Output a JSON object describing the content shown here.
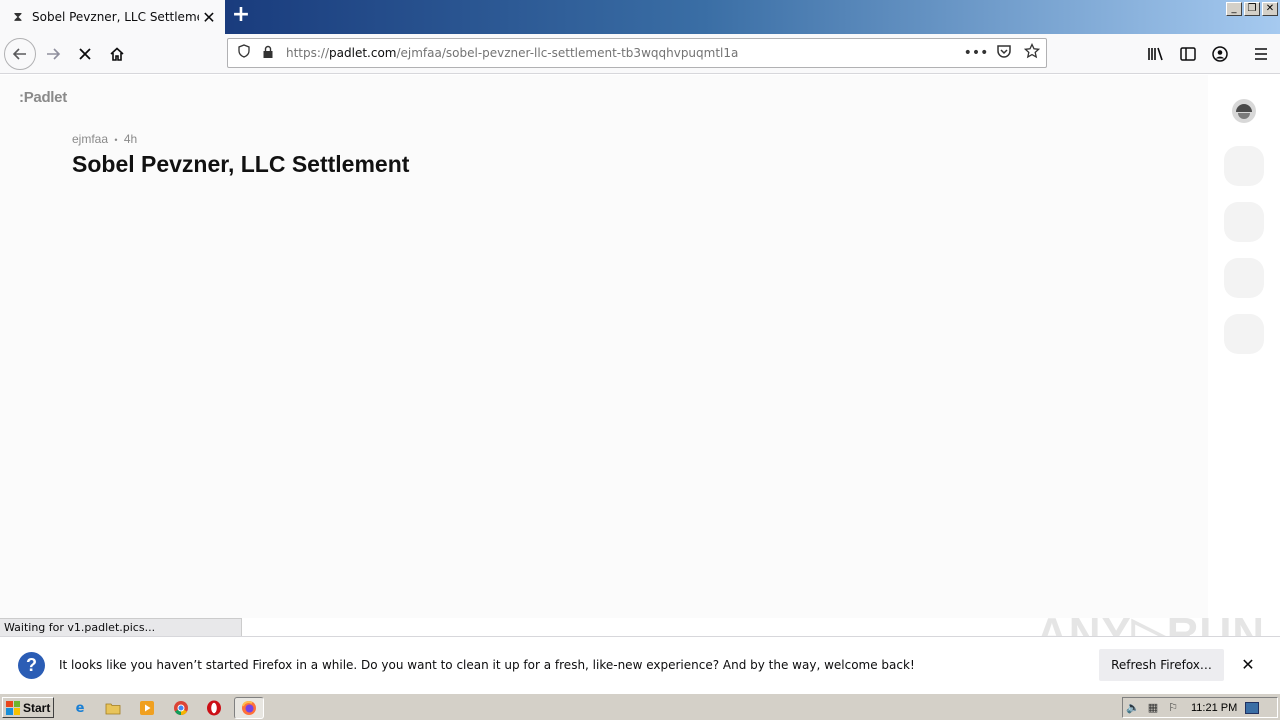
{
  "browser": {
    "tab": {
      "title": "Sobel Pevzner, LLC Settlement",
      "favicon": "hourglass-icon"
    },
    "new_tab_label": "+",
    "window_controls": [
      "_",
      "❐",
      "✕"
    ],
    "url": {
      "prefix": "https://",
      "host": "padlet.com",
      "path": "/ejmfaa/sobel-pevzner-llc-settlement-tb3wqqhvpuqmtl1a"
    },
    "status_text": "Waiting for v1.padlet.pics...",
    "notification": {
      "message": "It looks like you haven’t started Firefox in a while. Do you want to clean it up for a fresh, like-new experience? And by the way, welcome back!",
      "button_label": "Refresh Firefox…"
    }
  },
  "page": {
    "logo": ":Padlet",
    "author": "ejmfaa",
    "separator": "•",
    "age": "4h",
    "title": "Sobel Pevzner, LLC Settlement"
  },
  "watermark": "ANY▷RUN",
  "taskbar": {
    "start_label": "Start",
    "clock": "11:21 PM",
    "apps": [
      "ie-icon",
      "folder-icon",
      "media-player-icon",
      "chrome-icon",
      "opera-icon",
      "firefox-icon"
    ]
  },
  "colors": {
    "title_bar_start": "#0a246a",
    "title_bar_end": "#a6caf0",
    "notification_icon": "#2b5db5",
    "taskbar": "#d4d0c8"
  }
}
